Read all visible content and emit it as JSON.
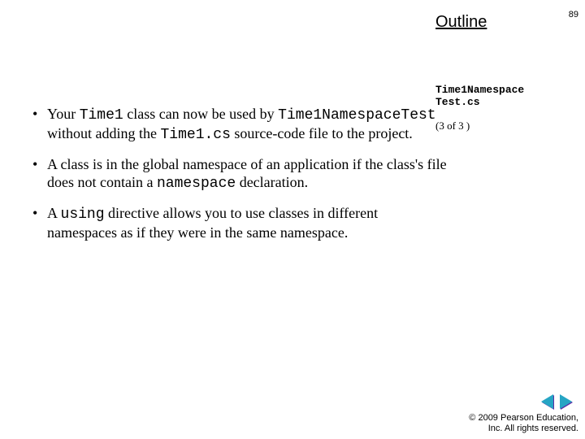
{
  "header": {
    "outline_label": "Outline",
    "page_number": "89"
  },
  "rightcol": {
    "file_label_line1": "Time1Namespace",
    "file_label_line2": "Test.cs",
    "page_of": "(3 of 3 )"
  },
  "bullets": [
    {
      "pre": "Your ",
      "code1": "Time1",
      "mid1": " class can now be used by ",
      "code2": "Time1NamespaceTest",
      "mid2": " without adding the ",
      "code3": "Time1.cs",
      "post": " source-code file to the project."
    },
    {
      "pre": "A class is in the global namespace of an application if the class's file does not contain a ",
      "code1": "namespace",
      "post": " declaration."
    },
    {
      "pre": "A ",
      "code1": "using",
      "post": " directive allows you to use classes in different namespaces as if they were in the same namespace."
    }
  ],
  "footer": {
    "line1": "© 2009 Pearson Education,",
    "line2": "Inc.  All rights reserved."
  },
  "nav": {
    "prev": "previous-slide",
    "next": "next-slide"
  }
}
